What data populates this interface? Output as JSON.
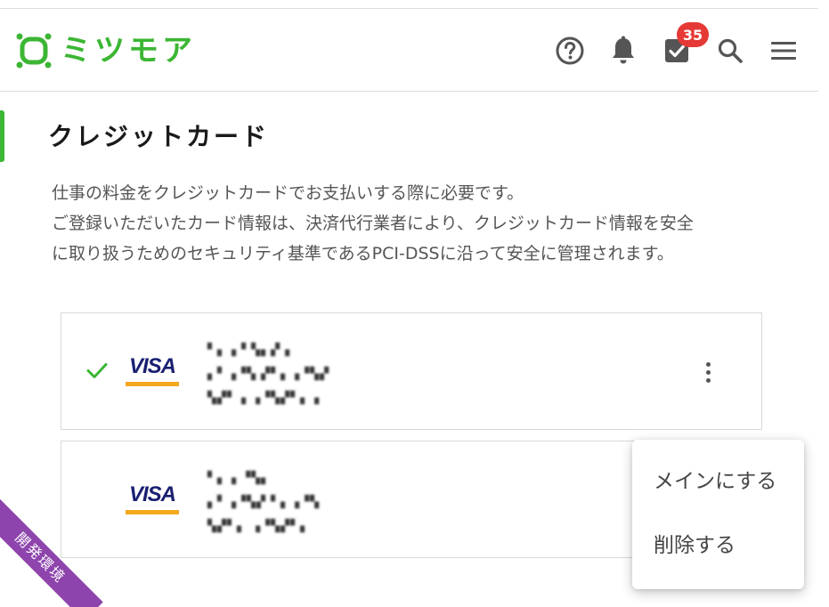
{
  "header": {
    "logo_text": "ミツモア",
    "badge_count": "35",
    "icons": [
      "help-circle-icon",
      "bell-icon",
      "checkbox-icon",
      "search-icon",
      "hamburger-menu-icon"
    ]
  },
  "section": {
    "title": "クレジットカード",
    "description_lines": [
      "仕事の料金をクレジットカードでお支払いする際に必要です。",
      "ご登録いただいたカード情報は、決済代行業者により、クレジットカード情報を安全",
      "に取り扱うためのセキュリティ基準であるPCI-DSSに沿って安全に管理されます。"
    ]
  },
  "cards": [
    {
      "brand": "VISA",
      "selected": true,
      "lines": [
        "▘▖▗▝ ▚▖▞▗",
        "▖▘▗▝▚ ▞▘▖▗▝▚▞",
        "▚▞▘ ▖▗▝▚▞▘▖▗"
      ]
    },
    {
      "brand": "VISA",
      "selected": false,
      "lines": [
        "▘▖▗ ▝▚▖",
        "▖▘▗▝▚▞ ▘▖▗▝▚",
        "▚▞▘▖ ▗▝▚▞▘▖"
      ]
    }
  ],
  "context_menu": {
    "items": [
      "メインにする",
      "削除する"
    ]
  },
  "environment_ribbon": "開発環境",
  "colors": {
    "brand_green": "#3cb634",
    "badge_red": "#e53935",
    "visa_blue": "#1a1f71",
    "visa_gold": "#f4a81d",
    "ribbon_purple": "#8e44ad"
  }
}
